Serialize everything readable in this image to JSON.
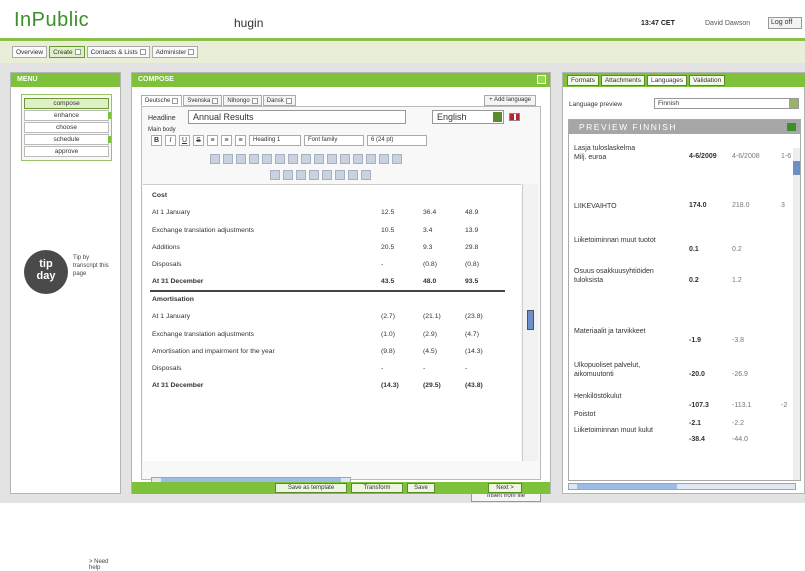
{
  "header": {
    "logo": "InPublic",
    "app": "hugin",
    "clock": "13:47 CET",
    "user": "David Dawson",
    "logoff": "Log off"
  },
  "nav": {
    "tabs": [
      "Overview",
      "Create",
      "Contacts & Lists",
      "Administer"
    ]
  },
  "menu": {
    "title": "MENU",
    "items": [
      "compose",
      "enhance",
      "choose",
      "schedule",
      "approve"
    ],
    "tip_logo": [
      "tip",
      "day"
    ],
    "tip_text": "Tip by transcript this page",
    "need_help": "> Need help"
  },
  "compose": {
    "title": "COMPOSE",
    "lang_tabs": [
      "Deutsche",
      "Svenska",
      "Nihongo",
      "Dansk"
    ],
    "add_language": "+ Add language",
    "headline_label": "Headline",
    "headline_value": "Annual Results",
    "main_body_label": "Main body",
    "language": "English",
    "toolbar": {
      "heading": "Heading 1",
      "font_family": "Font family",
      "font_size": "6 (24 pt)"
    },
    "insert_from_file": "Insert from file",
    "buttons": {
      "save_template": "Save as template",
      "transform": "Transform",
      "save": "Save",
      "next": "Next >"
    }
  },
  "table": {
    "rows": [
      {
        "label": "Cost",
        "v": [
          "",
          "",
          ""
        ],
        "bold": true
      },
      {
        "label": "At 1 January",
        "v": [
          "12.5",
          "36.4",
          "48.9"
        ]
      },
      {
        "label": "Exchange translation adjustments",
        "v": [
          "10.5",
          "3.4",
          "13.9"
        ]
      },
      {
        "label": "Additions",
        "v": [
          "20.5",
          "9.3",
          "29.8"
        ]
      },
      {
        "label": "Disposals",
        "v": [
          "-",
          "(0.8)",
          "(0.8)"
        ]
      },
      {
        "label": "At 31 December",
        "v": [
          "43.5",
          "48.0",
          "93.5"
        ],
        "bold": true,
        "sep": true
      },
      {
        "label": "Amortisation",
        "v": [
          "",
          "",
          ""
        ],
        "bold": true,
        "top": true
      },
      {
        "label": "At 1 January",
        "v": [
          "(2.7)",
          "(21.1)",
          "(23.8)"
        ]
      },
      {
        "label": "Exchange translation adjustments",
        "v": [
          "(1.0)",
          "(2.9)",
          "(4.7)"
        ]
      },
      {
        "label": "Amortisation and impairment for the year",
        "v": [
          "(9.8)",
          "(4.5)",
          "(14.3)"
        ]
      },
      {
        "label": "Disposals",
        "v": [
          "-",
          "-",
          "-"
        ]
      },
      {
        "label": "At 31 December",
        "v": [
          "(14.3)",
          "(29.5)",
          "(43.8)"
        ],
        "bold": true
      }
    ]
  },
  "right": {
    "tabs": [
      "Formats",
      "Attachments",
      "Languages",
      "Validation"
    ],
    "lang_preview_label": "Language preview",
    "lang_preview_value": "Finnish",
    "preview_title": "PREVIEW FINNISH",
    "preview_rows": [
      {
        "label": "Lasja tuloslaskelma\nMilj. euroa",
        "a": "4-6/2009",
        "b": "4-6/2008",
        "c": "1-6"
      },
      {
        "label": "LIIKEVAIHTO",
        "a": "174.0",
        "b": "218.0",
        "c": "3"
      },
      {
        "label": "Liiketoiminnan muut tuotot",
        "a": "0.1",
        "b": "0.2",
        "c": ""
      },
      {
        "label": "Osuus osakkuusyhtiöiden tuloksista",
        "a": "0.2",
        "b": "1.2",
        "c": ""
      },
      {
        "label": "Materiaalit ja tarvikkeet",
        "a": "-1.9",
        "b": "-3.8",
        "c": ""
      },
      {
        "label": "Ulkopuoliset palvelut, aikomuutonti",
        "a": "-20.0",
        "b": "-26.9",
        "c": ""
      },
      {
        "label": "Henkilöstökulut",
        "a": "-107.3",
        "b": "-113.1",
        "c": "-2"
      },
      {
        "label": "Poistot",
        "a": "-2.1",
        "b": "-2.2",
        "c": ""
      },
      {
        "label": "Liiketoiminnan muut kulut",
        "a": "-38.4",
        "b": "-44.0",
        "c": ""
      }
    ]
  },
  "colors": {
    "accent": "#7ec23c",
    "brand": "#3a8f2a"
  }
}
